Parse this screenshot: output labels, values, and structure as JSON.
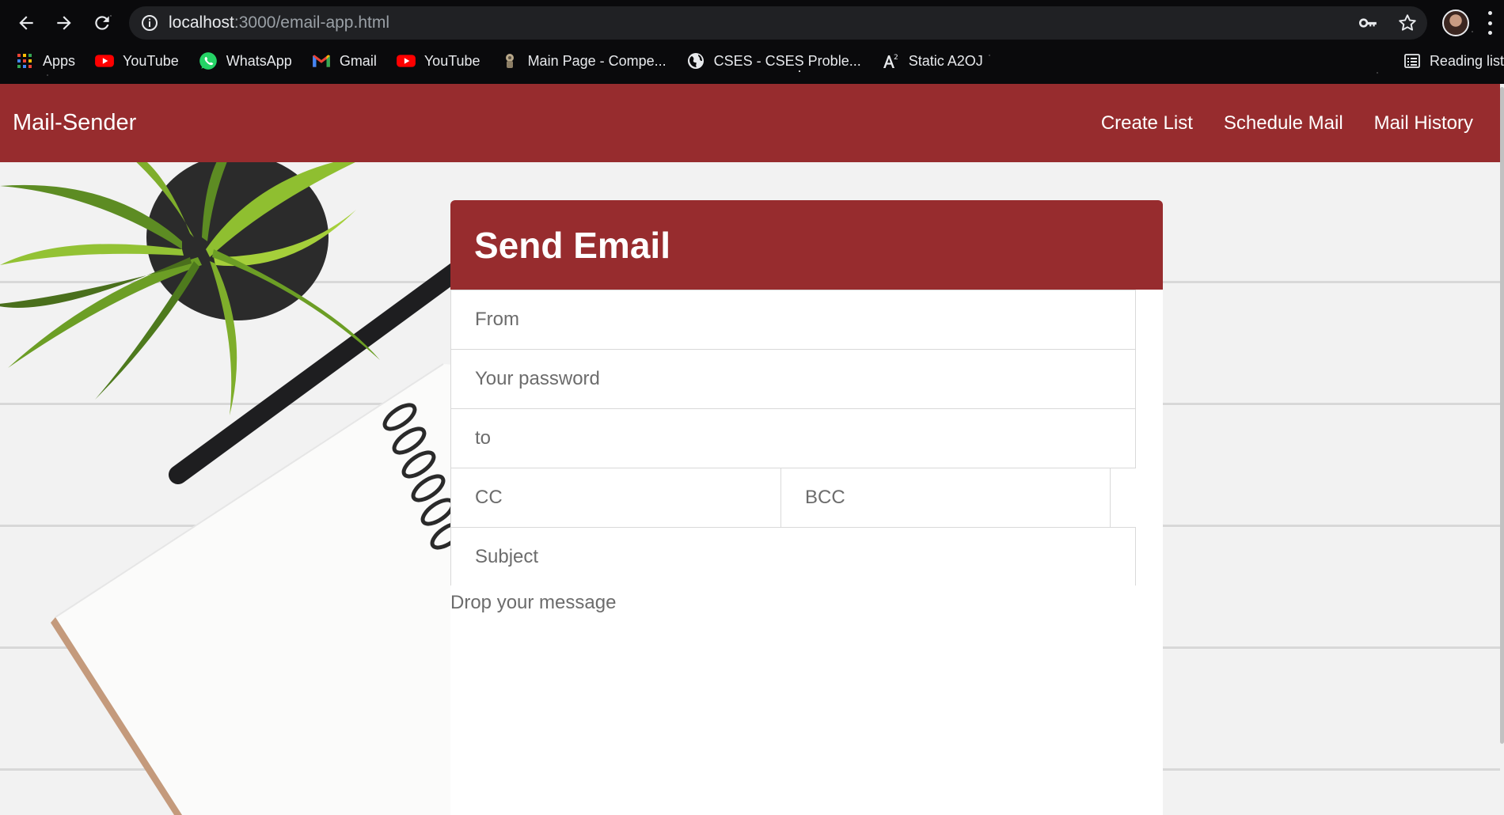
{
  "browser": {
    "url_host": "localhost",
    "url_path": ":3000/email-app.html",
    "bookmarks": [
      {
        "label": "Apps",
        "icon": "apps-grid-icon"
      },
      {
        "label": "YouTube",
        "icon": "youtube-icon"
      },
      {
        "label": "WhatsApp",
        "icon": "whatsapp-icon"
      },
      {
        "label": "Gmail",
        "icon": "gmail-icon"
      },
      {
        "label": "YouTube",
        "icon": "youtube-icon"
      },
      {
        "label": "Main Page - Compe...",
        "icon": "wiki-icon"
      },
      {
        "label": "CSES - CSES Proble...",
        "icon": "globe-icon"
      },
      {
        "label": "Static A2OJ",
        "icon": "a2oj-icon"
      }
    ],
    "reading_list": "Reading list"
  },
  "navbar": {
    "brand": "Mail-Sender",
    "links": [
      "Create List",
      "Schedule Mail",
      "Mail History"
    ]
  },
  "form": {
    "title": "Send Email",
    "from_placeholder": "From",
    "password_placeholder": "Your password",
    "to_placeholder": "to",
    "cc_placeholder": "CC",
    "bcc_placeholder": "BCC",
    "subject_placeholder": "Subject",
    "message_placeholder": "Drop your message"
  },
  "colors": {
    "brand": "#972c2e",
    "chrome_bg": "#0a0a0c",
    "omnibox_bg": "#202124"
  }
}
